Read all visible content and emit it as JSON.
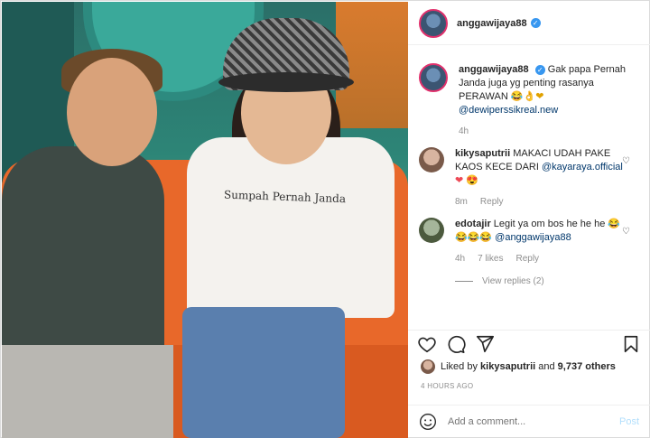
{
  "post": {
    "author": "anggawijaya88",
    "shirt_text": "Sumpah Pernah Janda"
  },
  "caption": {
    "username": "anggawijaya88",
    "text": "Gak papa Pernah Janda juga yg penting rasanya PERAWAN",
    "emoji": "😂👌❤",
    "mention": "@dewiperssikreal.new",
    "time": "4h"
  },
  "comments": [
    {
      "username": "kikysaputrii",
      "text": "MAKACI UDAH PAKE KAOS KECE DARI",
      "mention": "@kayaraya.official",
      "emoji": "❤ 😍",
      "time": "8m",
      "reply_label": "Reply"
    },
    {
      "username": "edotajir",
      "text": "Legit ya om bos he he he",
      "emoji": "😂😂😂😂",
      "mention": "@anggawijaya88",
      "time": "4h",
      "likes": "7 likes",
      "reply_label": "Reply",
      "view_replies": "View replies (2)"
    }
  ],
  "likes": {
    "prefix": "Liked by",
    "user": "kikysaputrii",
    "and": "and",
    "others": "9,737 others"
  },
  "timestamp": "4 HOURS AGO",
  "add_comment": {
    "placeholder": "Add a comment...",
    "post_label": "Post"
  },
  "colors": {
    "link": "#00376b",
    "verified": "#3897f0",
    "muted": "#8e8e8e",
    "post_disabled": "#b2dffc"
  },
  "icons": [
    "heart-icon",
    "comment-icon",
    "share-icon",
    "bookmark-icon",
    "smile-icon",
    "verified-icon"
  ]
}
